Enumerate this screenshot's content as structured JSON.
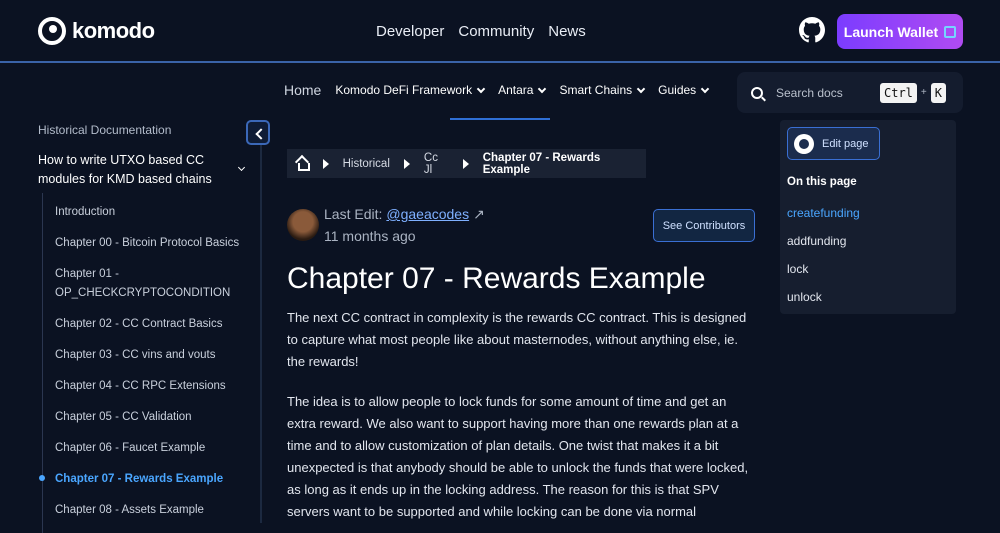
{
  "header": {
    "logo_text": "komodo",
    "nav": [
      "Developer",
      "Community",
      "News"
    ],
    "launch_label": "Launch Wallet"
  },
  "subnav": {
    "home": "Home",
    "items": [
      "Komodo DeFi Framework",
      "Antara",
      "Smart Chains",
      "Guides"
    ]
  },
  "search": {
    "placeholder": "Search docs",
    "key1": "Ctrl",
    "plus": "+",
    "key2": "K"
  },
  "sidebar": {
    "title": "Historical Documentation",
    "section": "How to write UTXO based CC modules for KMD based chains",
    "items": [
      "Introduction",
      "Chapter 00 - Bitcoin Protocol Basics",
      "Chapter 01 - OP_CHECKCRYPTOCONDITION",
      "Chapter 02 - CC Contract Basics",
      "Chapter 03 - CC vins and vouts",
      "Chapter 04 - CC RPC Extensions",
      "Chapter 05 - CC Validation",
      "Chapter 06 - Faucet Example",
      "Chapter 07 - Rewards Example",
      "Chapter 08 - Assets Example"
    ]
  },
  "breadcrumb": {
    "items": [
      "Historical",
      "Cc Jl",
      "Chapter 07 - Rewards Example"
    ]
  },
  "meta": {
    "last_edit_label": "Last Edit:",
    "author": "@gaeacodes",
    "author_arrow": "↗",
    "ago": "11 months ago",
    "contributors_label": "See Contributors"
  },
  "article": {
    "title": "Chapter 07 - Rewards Example",
    "p1": "The next CC contract in complexity is the rewards CC contract. This is designed to capture what most people like about masternodes, without anything else, ie. the rewards!",
    "p2": "The idea is to allow people to lock funds for some amount of time and get an extra reward. We also want to support having more than one rewards plan at a time and to allow customization of plan details. One twist that makes it a bit unexpected is that anybody should be able to unlock the funds that were locked, as long as it ends up in the locking address. The reason for this is that SPV servers want to be supported and while locking can be done via normal"
  },
  "toc": {
    "edit_label": "Edit page",
    "title": "On this page",
    "items": [
      "createfunding",
      "addfunding",
      "lock",
      "unlock"
    ]
  },
  "colors": {
    "background": "#0b1222",
    "accent": "#4aa6ff",
    "launch_gradient_start": "#7b3cff",
    "launch_gradient_end": "#b04bf2"
  }
}
